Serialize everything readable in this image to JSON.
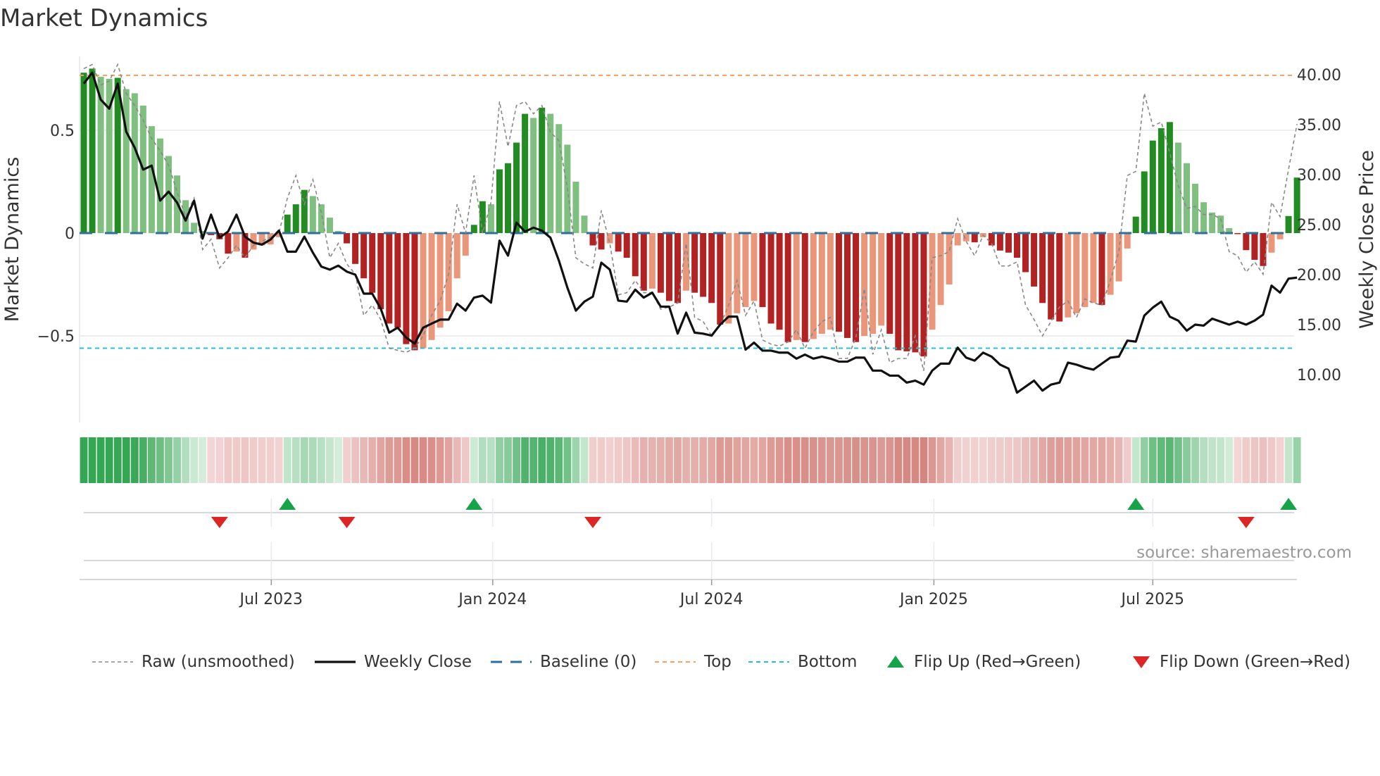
{
  "title": "Market Dynamics",
  "source": "source: sharemaestro.com",
  "colors": {
    "strong_up": "#228b22",
    "weak_up": "#7fbf7f",
    "strong_down": "#b22222",
    "weak_down": "#e9967a",
    "close": "#111111",
    "raw": "#888888",
    "baseline": "#2e6f9e",
    "top": "#f4a460",
    "bottom": "#22c3d6",
    "flip_up": "#16a34a",
    "flip_down": "#dc2626"
  },
  "legend": [
    {
      "label": "Raw (unsmoothed)",
      "kind": "raw"
    },
    {
      "label": "Weekly Close",
      "kind": "close"
    },
    {
      "label": "Baseline (0)",
      "kind": "baseline"
    },
    {
      "label": "Top",
      "kind": "top"
    },
    {
      "label": "Bottom",
      "kind": "bottom"
    },
    {
      "label": "Flip Up (Red→Green)",
      "kind": "flip_up"
    },
    {
      "label": "Flip Down (Green→Red)",
      "kind": "flip_down"
    }
  ],
  "chart_data": {
    "type": "bar",
    "title": "Market Dynamics",
    "ylabel": "Market Dynamics",
    "y2label": "Weekly Close Price",
    "ylim": [
      -0.82,
      0.86
    ],
    "y2lim": [
      6.5,
      42.5
    ],
    "yticks": [
      {
        "v": 0.5,
        "label": "0.5"
      },
      {
        "v": 0,
        "label": "0"
      },
      {
        "v": -0.5,
        "label": "−0.5"
      }
    ],
    "y2ticks": [
      {
        "v": 40,
        "label": "40.00"
      },
      {
        "v": 35,
        "label": "35.00"
      },
      {
        "v": 30,
        "label": "30.00"
      },
      {
        "v": 25,
        "label": "25.00"
      },
      {
        "v": 20,
        "label": "20.00"
      },
      {
        "v": 15,
        "label": "15.00"
      },
      {
        "v": 10,
        "label": "10.00"
      }
    ],
    "xticks": [
      {
        "week": 22.1,
        "label": "Jul 2023"
      },
      {
        "week": 48.2,
        "label": "Jan 2024"
      },
      {
        "week": 74.0,
        "label": "Jul 2024"
      },
      {
        "week": 100.2,
        "label": "Jan 2025"
      },
      {
        "week": 126.0,
        "label": "Jul 2025"
      }
    ],
    "top_level": 0.767,
    "bottom_level": -0.56,
    "baseline": 0,
    "dynamics": [
      0.78,
      0.8,
      0.76,
      0.75,
      0.755,
      0.7,
      0.68,
      0.62,
      0.52,
      0.46,
      0.375,
      0.28,
      0.16,
      0.05,
      0.01,
      -0.01,
      -0.03,
      -0.1,
      -0.09,
      -0.12,
      -0.08,
      -0.06,
      -0.055,
      -0.02,
      0.09,
      0.14,
      0.21,
      0.18,
      0.14,
      0.075,
      0.01,
      -0.05,
      -0.15,
      -0.22,
      -0.29,
      -0.37,
      -0.44,
      -0.46,
      -0.54,
      -0.57,
      -0.56,
      -0.52,
      -0.46,
      -0.38,
      -0.22,
      -0.11,
      0.04,
      0.155,
      0.14,
      0.31,
      0.34,
      0.44,
      0.58,
      0.56,
      0.61,
      0.58,
      0.53,
      0.43,
      0.25,
      0.085,
      -0.06,
      -0.08,
      -0.05,
      -0.09,
      -0.12,
      -0.21,
      -0.28,
      -0.27,
      -0.29,
      -0.33,
      -0.34,
      -0.28,
      -0.29,
      -0.31,
      -0.34,
      -0.445,
      -0.44,
      -0.39,
      -0.36,
      -0.33,
      -0.36,
      -0.44,
      -0.47,
      -0.53,
      -0.52,
      -0.53,
      -0.515,
      -0.49,
      -0.47,
      -0.48,
      -0.51,
      -0.53,
      -0.5,
      -0.49,
      -0.45,
      -0.49,
      -0.57,
      -0.575,
      -0.58,
      -0.6,
      -0.47,
      -0.35,
      -0.25,
      -0.06,
      -0.04,
      -0.045,
      -0.02,
      -0.06,
      -0.085,
      -0.095,
      -0.12,
      -0.19,
      -0.26,
      -0.34,
      -0.42,
      -0.43,
      -0.41,
      -0.39,
      -0.36,
      -0.34,
      -0.35,
      -0.3,
      -0.235,
      -0.075,
      0.08,
      0.3,
      0.45,
      0.51,
      0.54,
      0.44,
      0.34,
      0.24,
      0.15,
      0.1,
      0.085,
      0.024,
      -0.005,
      -0.083,
      -0.13,
      -0.16,
      -0.095,
      -0.03,
      0.083,
      0.27
    ],
    "raw": [
      0.8,
      0.82,
      0.72,
      0.74,
      0.82,
      0.68,
      0.62,
      0.55,
      0.46,
      0.4,
      0.33,
      0.2,
      0.08,
      0.17,
      -0.08,
      -0.03,
      -0.17,
      -0.12,
      -0.06,
      -0.12,
      -0.06,
      -0.04,
      -0.02,
      0.0,
      0.17,
      0.28,
      0.14,
      0.26,
      0.1,
      -0.12,
      -0.05,
      -0.15,
      -0.2,
      -0.4,
      -0.35,
      -0.42,
      -0.56,
      -0.57,
      -0.58,
      -0.56,
      -0.5,
      -0.4,
      -0.33,
      -0.2,
      0.14,
      0.0,
      0.28,
      0.0,
      0.15,
      0.64,
      0.42,
      0.62,
      0.64,
      0.58,
      0.62,
      0.49,
      0.45,
      0.22,
      -0.12,
      -0.15,
      -0.17,
      0.11,
      -0.05,
      -0.3,
      -0.29,
      -0.23,
      -0.29,
      -0.29,
      -0.37,
      -0.36,
      -0.34,
      -0.05,
      -0.41,
      -0.43,
      -0.5,
      -0.45,
      -0.35,
      -0.23,
      -0.4,
      -0.33,
      -0.52,
      -0.54,
      -0.55,
      -0.53,
      -0.47,
      -0.56,
      -0.48,
      -0.43,
      -0.41,
      -0.61,
      -0.61,
      -0.51,
      -0.27,
      -0.59,
      -0.47,
      -0.63,
      -0.61,
      -0.61,
      -0.5,
      -0.67,
      -0.12,
      -0.11,
      -0.09,
      0.07,
      -0.04,
      -0.11,
      -0.01,
      -0.05,
      -0.16,
      -0.16,
      -0.14,
      -0.35,
      -0.42,
      -0.5,
      -0.43,
      -0.36,
      -0.33,
      -0.41,
      -0.32,
      -0.34,
      -0.35,
      -0.23,
      -0.09,
      0.28,
      0.3,
      0.68,
      0.52,
      0.54,
      0.39,
      0.23,
      0.12,
      0.13,
      0.09,
      0.09,
      0.07,
      -0.09,
      -0.11,
      -0.19,
      -0.14,
      -0.2,
      0.15,
      0.08,
      0.31,
      0.53
    ],
    "close": [
      39.1,
      40.2,
      37.5,
      36.6,
      39.1,
      34.3,
      32.7,
      30.5,
      30.9,
      27.4,
      28.3,
      27.2,
      25.4,
      27.4,
      23.6,
      26.0,
      23.7,
      24.3,
      26.0,
      23.8,
      23.2,
      23.0,
      23.5,
      24.4,
      22.3,
      22.3,
      23.8,
      22.2,
      20.8,
      20.5,
      20.9,
      20.3,
      20.0,
      18.1,
      18.1,
      16.6,
      14.2,
      14.7,
      13.7,
      13.1,
      14.7,
      15.1,
      15.5,
      15.5,
      17.1,
      16.4,
      17.7,
      17.9,
      17.2,
      23.4,
      21.9,
      25.2,
      24.3,
      24.7,
      24.4,
      23.7,
      21.4,
      18.7,
      16.4,
      17.3,
      17.8,
      21.2,
      20.5,
      17.4,
      17.3,
      18.5,
      17.7,
      18.2,
      16.8,
      16.8,
      14.1,
      16.2,
      14.2,
      14.1,
      13.9,
      15.0,
      15.8,
      15.8,
      12.5,
      13.2,
      12.4,
      12.4,
      12.2,
      12.2,
      11.6,
      12.0,
      11.6,
      11.8,
      11.6,
      11.3,
      11.3,
      11.7,
      11.7,
      10.4,
      10.4,
      9.9,
      9.9,
      9.2,
      9.4,
      9.0,
      10.4,
      11.1,
      11.1,
      12.7,
      11.7,
      11.4,
      12.2,
      11.8,
      11.0,
      10.6,
      8.2,
      8.8,
      9.4,
      8.4,
      9.0,
      9.2,
      11.2,
      11.0,
      10.7,
      10.5,
      11.1,
      11.7,
      11.8,
      13.4,
      13.3,
      15.9,
      16.7,
      17.3,
      15.8,
      15.4,
      14.4,
      15.0,
      14.9,
      15.6,
      15.3,
      15.0,
      15.3,
      15.0,
      15.4,
      16.0,
      18.9,
      18.2,
      19.6,
      19.7
    ],
    "flips": [
      {
        "week": 16,
        "type": "down"
      },
      {
        "week": 24,
        "type": "up"
      },
      {
        "week": 31,
        "type": "down"
      },
      {
        "week": 46,
        "type": "up"
      },
      {
        "week": 60,
        "type": "down"
      },
      {
        "week": 124,
        "type": "up"
      },
      {
        "week": 137,
        "type": "down"
      },
      {
        "week": 142,
        "type": "up"
      }
    ],
    "legend_position": "bottom"
  }
}
